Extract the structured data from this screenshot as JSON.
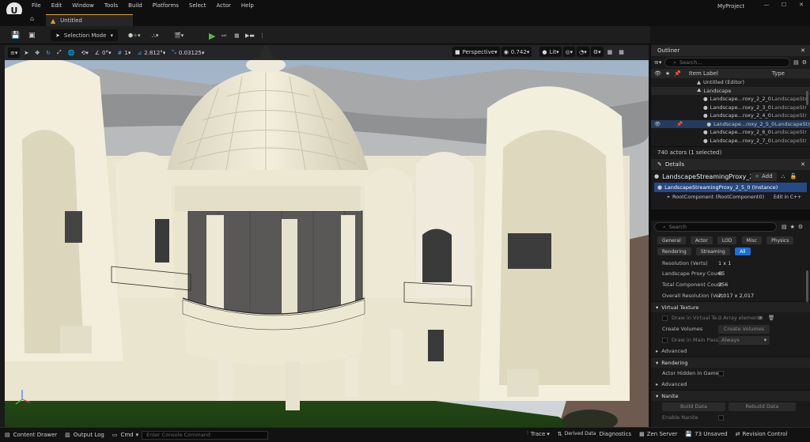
{
  "window": {
    "menu": [
      "File",
      "Edit",
      "Window",
      "Tools",
      "Build",
      "Platforms",
      "Select",
      "Actor",
      "Help"
    ],
    "project_name": "MyProject",
    "doc_tab": "Untitled"
  },
  "toolbar": {
    "selection_mode": "Selection Mode"
  },
  "viewport_toolbar": {
    "rotation_snap": "0°",
    "grid_snap": "1",
    "scale_snap": "2.812°",
    "camera_speed": "0.03125",
    "view_mode": "Perspective",
    "fov": "0.742",
    "lit_mode": "Lit"
  },
  "outliner": {
    "tab_label": "Outliner",
    "search_placeholder": "Search...",
    "col_label": "Item Label",
    "col_type": "Type",
    "rows": [
      {
        "label": "Untitled (Editor)",
        "type": ""
      },
      {
        "label": "Landscape",
        "type": ""
      },
      {
        "label": "Landscape...roxy_2_2_0",
        "type": "LandscapeStr"
      },
      {
        "label": "Landscape...roxy_2_3_0",
        "type": "LandscapeStr"
      },
      {
        "label": "Landscape...roxy_2_4_0",
        "type": "LandscapeStr"
      },
      {
        "label": "Landscape...roxy_2_5_0",
        "type": "LandscapeStr"
      },
      {
        "label": "Landscape...roxy_2_6_0",
        "type": "LandscapeStr"
      },
      {
        "label": "Landscape...roxy_2_7_0",
        "type": "LandscapeStr"
      }
    ],
    "actor_count": "740 actors (1 selected)"
  },
  "details": {
    "tab_label": "Details",
    "actor_name": "LandscapeStreamingProxy_2",
    "add_label": "Add",
    "instance_label": "LandscapeStreamingProxy_2_5_0 (Instance)",
    "root_component": "RootComponent (RootComponent0)",
    "edit_in_cpp": "Edit in C++",
    "search_placeholder": "Search",
    "filters": [
      "General",
      "Actor",
      "LOD",
      "Misc",
      "Physics",
      "Rendering",
      "Streaming",
      "All"
    ],
    "props": [
      {
        "name": "Resolution (Verts)",
        "value": "1 x 1"
      },
      {
        "name": "Landscape Proxy Count",
        "value": "65"
      },
      {
        "name": "Total Component Count",
        "value": "256"
      },
      {
        "name": "Overall Resolution (Vert:",
        "value": "2,017 x 2,017"
      }
    ],
    "virtual_texture": {
      "header": "Virtual Texture",
      "draw_in_vt": "Draw in Virtual Te...",
      "array_elements": "0 Array element",
      "create_volumes_label": "Create Volumes",
      "create_volumes_btn": "Create Volumes",
      "draw_in_main_pass": "Draw in Main Pass",
      "draw_in_main_pass_value": "Always",
      "advanced": "Advanced"
    },
    "rendering": {
      "header": "Rendering",
      "actor_hidden": "Actor Hidden In Game",
      "advanced": "Advanced"
    },
    "nanite": {
      "header": "Nanite",
      "build_data": "Build Data",
      "rebuild_data": "Rebuild Data",
      "enable_nanite": "Enable Nanite"
    }
  },
  "statusbar": {
    "content_drawer": "Content Drawer",
    "output_log": "Output Log",
    "cmd": "Cmd",
    "console_placeholder": "Enter Console Command",
    "trace": "Trace",
    "derived_data": "Derived Data",
    "diagnostics": "Diagnostics",
    "zen_server": "Zen Server",
    "unsaved": "73 Unsaved",
    "revision_control": "Revision Control"
  }
}
